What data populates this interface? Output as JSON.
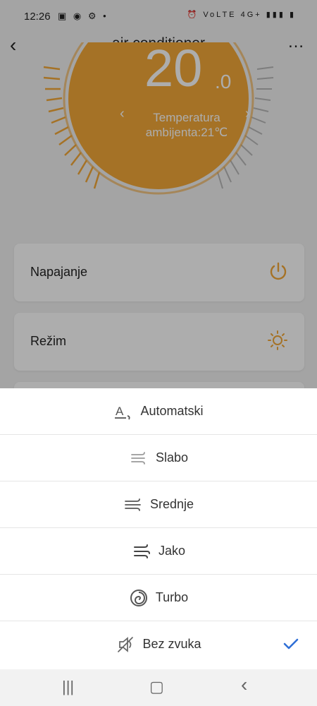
{
  "status_bar": {
    "time": "12:26",
    "left_icons": "▣ ◉ ⚙ •",
    "right_icons": "⏰ VoLTE 4G+ ▮▮▮ ▮"
  },
  "header": {
    "title": "air conditioner"
  },
  "thermostat": {
    "temp_integer": "20",
    "temp_decimal": ".0",
    "ambient_line1": "Temperatura",
    "ambient_line2": "ambijenta:21℃",
    "accent_color": "#f4a938"
  },
  "cards": [
    {
      "label": "Napajanje",
      "icon": "power-icon"
    },
    {
      "label": "Režim",
      "icon": "sun-icon"
    }
  ],
  "sheet": {
    "options": [
      {
        "label": "Automatski",
        "icon": "auto-fan-icon",
        "selected": false
      },
      {
        "label": "Slabo",
        "icon": "wind-low-icon",
        "selected": false
      },
      {
        "label": "Srednje",
        "icon": "wind-medium-icon",
        "selected": false
      },
      {
        "label": "Jako",
        "icon": "wind-high-icon",
        "selected": false
      },
      {
        "label": "Turbo",
        "icon": "turbo-icon",
        "selected": false
      },
      {
        "label": "Bez zvuka",
        "icon": "mute-icon",
        "selected": true
      }
    ],
    "check_color": "#2f6fd6"
  },
  "navbar": {
    "recent": "|||",
    "home": "▢",
    "back": "‹"
  }
}
